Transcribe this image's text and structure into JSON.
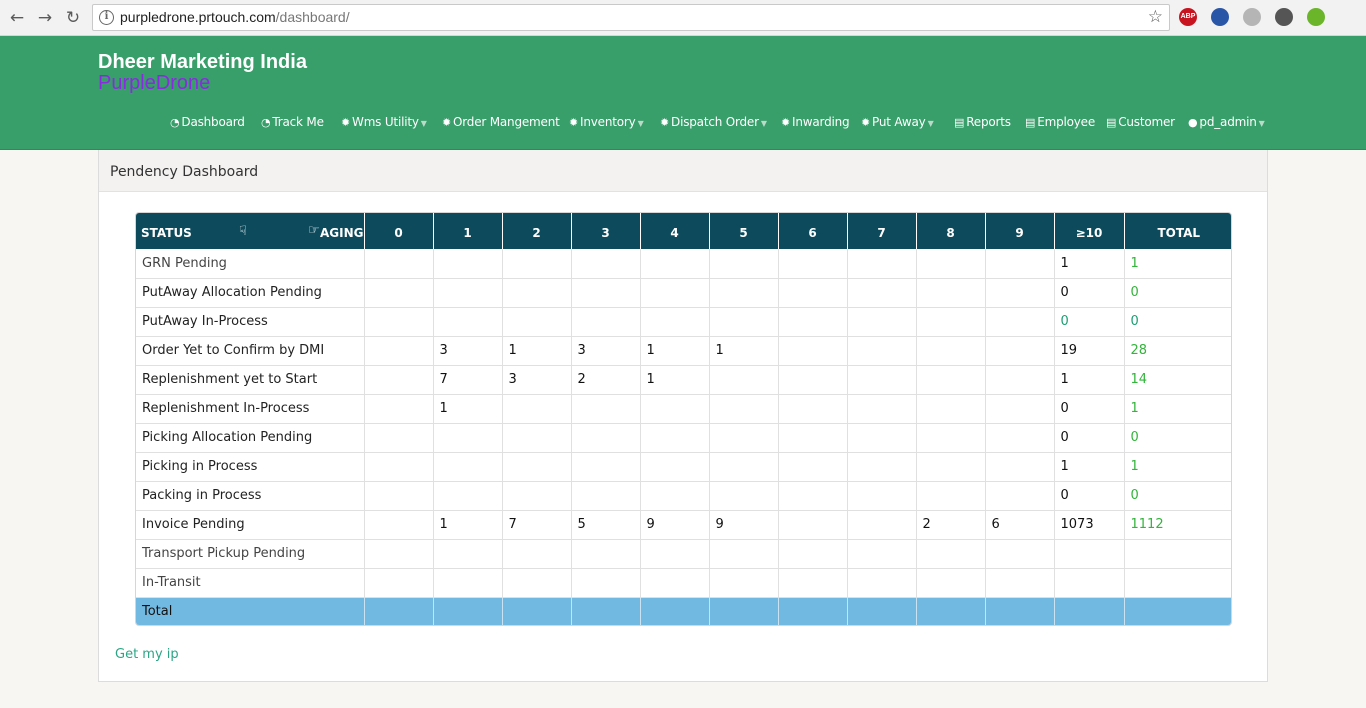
{
  "browser": {
    "url_host": "purpledrone.prtouch.com",
    "url_path": "/dashboard/",
    "extensions": [
      {
        "name": "adblock-icon",
        "label": "ABP",
        "color": "#c7141f"
      },
      {
        "name": "extension-globe-icon",
        "label": "",
        "color": "#2a56a8"
      },
      {
        "name": "extension-mail-icon",
        "label": "",
        "color": "#b5b5b5"
      },
      {
        "name": "extension-bug-icon",
        "label": "",
        "color": "#555555"
      },
      {
        "name": "extension-download-icon",
        "label": "",
        "color": "#6bb52b"
      }
    ]
  },
  "header": {
    "company": "Dheer Marketing India",
    "product": "PurpleDrone"
  },
  "menu": [
    {
      "label": "Dashboard",
      "icon": "dashboard-icon",
      "glyph": "◔",
      "caret": false
    },
    {
      "label": "Track Me",
      "icon": "dashboard-icon",
      "glyph": "◔",
      "caret": false
    },
    {
      "label": "Wms Utility",
      "icon": "gear-icon",
      "glyph": "✹",
      "caret": true
    },
    {
      "label": "Order Mangement",
      "icon": "gear-icon",
      "glyph": "✹",
      "caret": false
    },
    {
      "label": "Inventory",
      "icon": "gear-icon",
      "glyph": "✹",
      "caret": true
    },
    {
      "label": "Dispatch Order",
      "icon": "gear-icon",
      "glyph": "✹",
      "caret": true
    },
    {
      "label": "Inwarding",
      "icon": "gear-icon",
      "glyph": "✹",
      "caret": false
    },
    {
      "label": "Put Away",
      "icon": "gear-icon",
      "glyph": "✹",
      "caret": true
    },
    {
      "label": "Reports",
      "icon": "card-icon",
      "glyph": "▤",
      "caret": false
    },
    {
      "label": "Employee",
      "icon": "card-icon",
      "glyph": "▤",
      "caret": false
    },
    {
      "label": "Customer",
      "icon": "card-icon",
      "glyph": "▤",
      "caret": false
    },
    {
      "label": "pd_admin",
      "icon": "user-icon",
      "glyph": "●",
      "caret": true
    }
  ],
  "panel": {
    "title": "Pendency Dashboard"
  },
  "table": {
    "status_label": "STATUS",
    "aging_label": "AGING",
    "columns": [
      "0",
      "1",
      "2",
      "3",
      "4",
      "5",
      "6",
      "7",
      "8",
      "9",
      "≥10",
      "TOTAL"
    ],
    "rows": [
      {
        "label": "GRN Pending",
        "soft": true,
        "cells": [
          "",
          "",
          "",
          "",
          "",
          "",
          "",
          "",
          "",
          "",
          "1",
          "1"
        ],
        "ge10_style": "",
        "total_style": "green"
      },
      {
        "label": "PutAway Allocation Pending",
        "soft": false,
        "cells": [
          "",
          "",
          "",
          "",
          "",
          "",
          "",
          "",
          "",
          "",
          "0",
          "0"
        ],
        "ge10_style": "",
        "total_style": "green"
      },
      {
        "label": "PutAway In-Process",
        "soft": false,
        "cells": [
          "",
          "",
          "",
          "",
          "",
          "",
          "",
          "",
          "",
          "",
          "0",
          "0"
        ],
        "ge10_style": "teal",
        "total_style": "teal"
      },
      {
        "label": "Order Yet to Confirm by DMI",
        "soft": false,
        "cells": [
          "",
          "3",
          "1",
          "3",
          "1",
          "1",
          "",
          "",
          "",
          "",
          "19",
          "28"
        ],
        "ge10_style": "",
        "total_style": "green"
      },
      {
        "label": "Replenishment yet to Start",
        "soft": false,
        "cells": [
          "",
          "7",
          "3",
          "2",
          "1",
          "",
          "",
          "",
          "",
          "",
          "1",
          "14"
        ],
        "ge10_style": "",
        "total_style": "green"
      },
      {
        "label": "Replenishment In-Process",
        "soft": false,
        "cells": [
          "",
          "1",
          "",
          "",
          "",
          "",
          "",
          "",
          "",
          "",
          "0",
          "1"
        ],
        "ge10_style": "",
        "total_style": "green"
      },
      {
        "label": "Picking Allocation Pending",
        "soft": false,
        "cells": [
          "",
          "",
          "",
          "",
          "",
          "",
          "",
          "",
          "",
          "",
          "0",
          "0"
        ],
        "ge10_style": "",
        "total_style": "green"
      },
      {
        "label": "Picking in Process",
        "soft": false,
        "cells": [
          "",
          "",
          "",
          "",
          "",
          "",
          "",
          "",
          "",
          "",
          "1",
          "1"
        ],
        "ge10_style": "",
        "total_style": "green"
      },
      {
        "label": "Packing in Process",
        "soft": false,
        "cells": [
          "",
          "",
          "",
          "",
          "",
          "",
          "",
          "",
          "",
          "",
          "0",
          "0"
        ],
        "ge10_style": "",
        "total_style": "green"
      },
      {
        "label": "Invoice Pending",
        "soft": false,
        "cells": [
          "",
          "1",
          "7",
          "5",
          "9",
          "9",
          "",
          "",
          "2",
          "6",
          "1073",
          "1112"
        ],
        "ge10_style": "",
        "total_style": "green"
      },
      {
        "label": "Transport Pickup Pending",
        "soft": true,
        "cells": [
          "",
          "",
          "",
          "",
          "",
          "",
          "",
          "",
          "",
          "",
          "",
          ""
        ],
        "ge10_style": "",
        "total_style": "green"
      },
      {
        "label": "In-Transit",
        "soft": true,
        "cells": [
          "",
          "",
          "",
          "",
          "",
          "",
          "",
          "",
          "",
          "",
          "",
          ""
        ],
        "ge10_style": "",
        "total_style": "green"
      }
    ],
    "total_label": "Total"
  },
  "footer": {
    "link": "Get my ip"
  }
}
